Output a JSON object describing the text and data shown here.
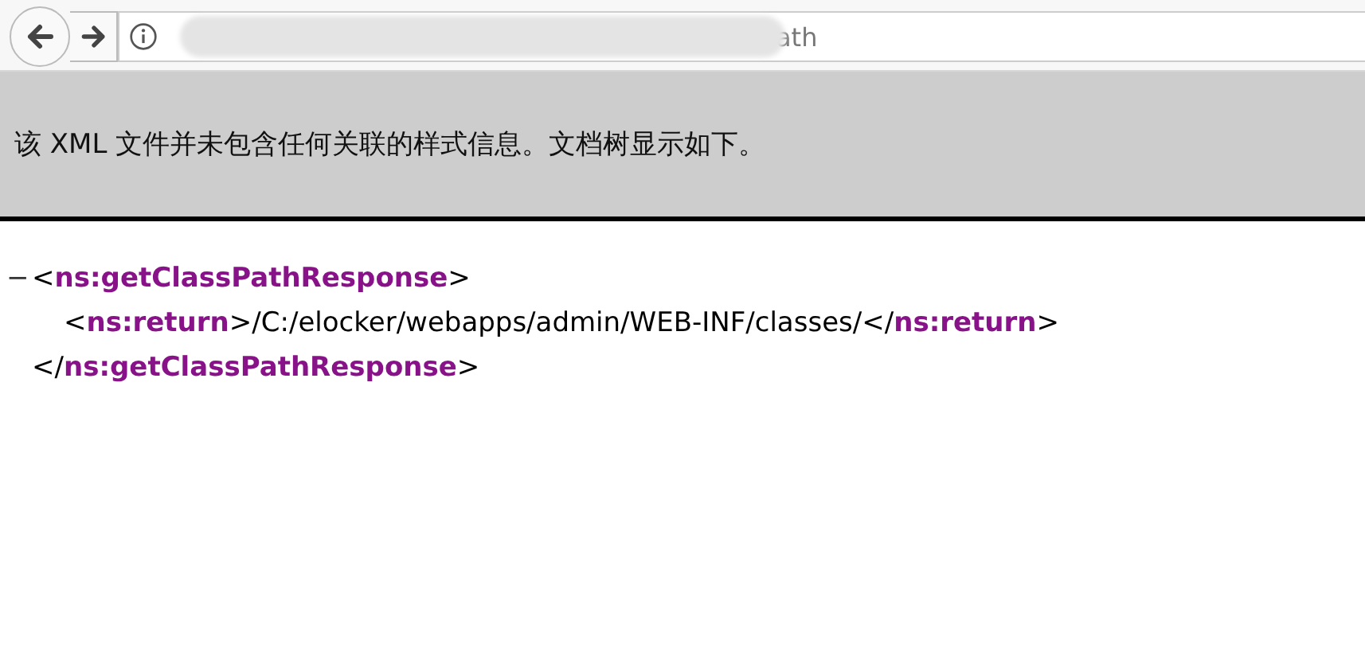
{
  "toolbar": {
    "url_visible": "ath"
  },
  "info_bar": {
    "message": "该 XML 文件并未包含任何关联的样式信息。文档树显示如下。"
  },
  "xml": {
    "toggle": "−",
    "lines": [
      [
        {
          "kind": "punct",
          "text": "<"
        },
        {
          "kind": "tag",
          "text": "ns:getClassPathResponse"
        },
        {
          "kind": "punct",
          "text": ">"
        }
      ],
      [
        {
          "kind": "punct",
          "text": "<"
        },
        {
          "kind": "tag",
          "text": "ns:return"
        },
        {
          "kind": "punct",
          "text": ">/C:/elocker/webapps/admin/WEB-INF/classes/</"
        },
        {
          "kind": "tag",
          "text": "ns:return"
        },
        {
          "kind": "punct",
          "text": ">"
        }
      ],
      [
        {
          "kind": "punct",
          "text": "</"
        },
        {
          "kind": "tag",
          "text": "ns:getClassPathResponse"
        },
        {
          "kind": "punct",
          "text": ">"
        }
      ]
    ]
  }
}
